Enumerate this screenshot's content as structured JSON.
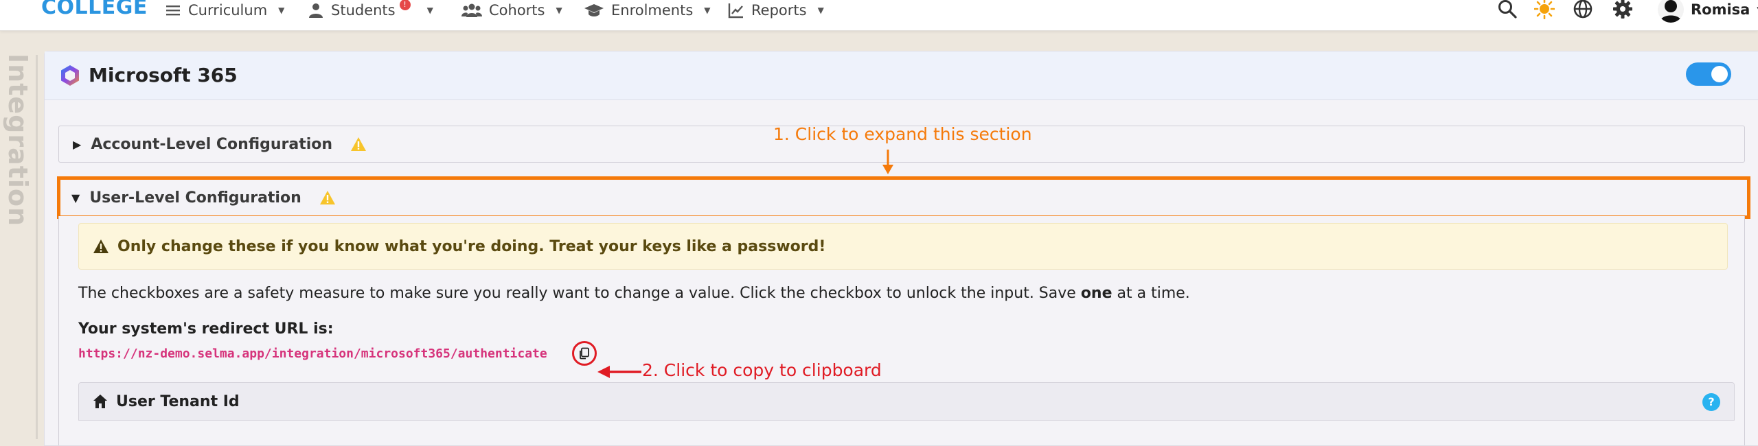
{
  "nav": {
    "brand": "COLLEGE",
    "items": [
      {
        "label": "Curriculum",
        "icon": "list-icon"
      },
      {
        "label": "Students",
        "icon": "person-icon",
        "badge": "!"
      },
      {
        "label": "Cohorts",
        "icon": "users-icon"
      },
      {
        "label": "Enrolments",
        "icon": "graduation-cap-icon"
      },
      {
        "label": "Reports",
        "icon": "chart-line-icon"
      }
    ],
    "user_name": "Romisa"
  },
  "rail": {
    "label": "Integration"
  },
  "card": {
    "title": "Microsoft 365",
    "toggle_on": true,
    "sections": [
      {
        "label": "Account-Level Configuration",
        "expanded": false
      },
      {
        "label": "User-Level Configuration",
        "expanded": true
      }
    ],
    "alert": "Only change these if you know what you're doing. Treat your keys like a password!",
    "description_pre": "The checkboxes are a safety measure to make sure you really want to change a value. Click the checkbox to unlock the input. Save ",
    "description_bold": "one",
    "description_post": " at a time.",
    "redirect_label": "Your system's redirect URL is:",
    "redirect_url": "https://nz-demo.selma.app/integration/microsoft365/authenticate",
    "tenant_label": "User Tenant Id",
    "help": "?"
  },
  "annotations": {
    "step1": "1. Click to expand this section",
    "step2": "2. Click to copy to clipboard"
  },
  "colors": {
    "brand": "#2b95e0",
    "accent_orange": "#f57a0a",
    "accent_red": "#e01b24",
    "url": "#d6337b",
    "toggle": "#2a96ea"
  }
}
